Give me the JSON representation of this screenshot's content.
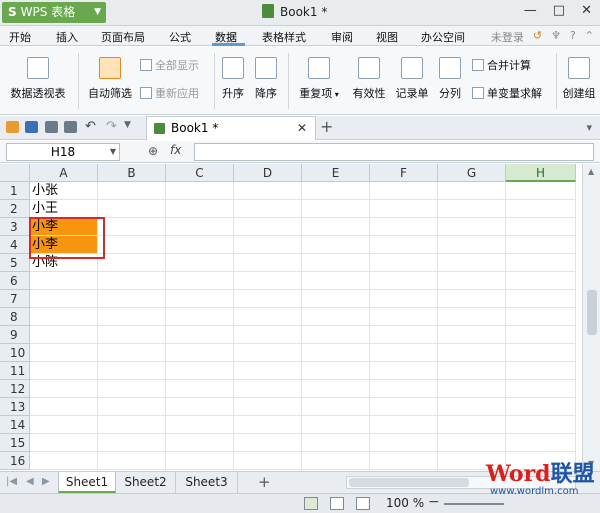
{
  "app": {
    "name": "WPS 表格",
    "logo_letter": "S",
    "doc_title": "Book1 *"
  },
  "menu": {
    "tabs": [
      "开始",
      "插入",
      "页面布局",
      "公式",
      "数据",
      "表格样式",
      "审阅",
      "视图",
      "办公空间"
    ],
    "active": "数据",
    "login": "未登录"
  },
  "ribbon": {
    "pivot": "数据透视表",
    "autofilter": "自动筛选",
    "show_all": "全部显示",
    "reapply": "重新应用",
    "sort_asc": "升序",
    "sort_desc": "降序",
    "duplicates": "重复项",
    "validation": "有效性",
    "record": "记录单",
    "split": "分列",
    "consolidate": "合并计算",
    "solver": "单变量求解",
    "create_group": "创建组"
  },
  "doc_tab": {
    "label": "Book1 *"
  },
  "formula_bar": {
    "cell_ref": "H18",
    "fx_label": "fx",
    "content": ""
  },
  "grid": {
    "columns": [
      "A",
      "B",
      "C",
      "D",
      "E",
      "F",
      "G",
      "H"
    ],
    "selected_column": "H",
    "rows": [
      "1",
      "2",
      "3",
      "4",
      "5",
      "6",
      "7",
      "8",
      "9",
      "10",
      "11",
      "12",
      "13",
      "14",
      "15",
      "16"
    ],
    "cells": {
      "A1": "小张",
      "A2": "小王",
      "A3": "小李",
      "A4": "小李",
      "A5": "小陈"
    },
    "highlight_color": "#f7960e",
    "highlighted_cells": [
      "A3",
      "A4"
    ]
  },
  "sheets": {
    "tabs": [
      "Sheet1",
      "Sheet2",
      "Sheet3"
    ],
    "active": "Sheet1"
  },
  "status": {
    "zoom": "100 %"
  },
  "watermark": {
    "word": "Word",
    "brand": "联盟",
    "url": "www.wordlm.com"
  }
}
